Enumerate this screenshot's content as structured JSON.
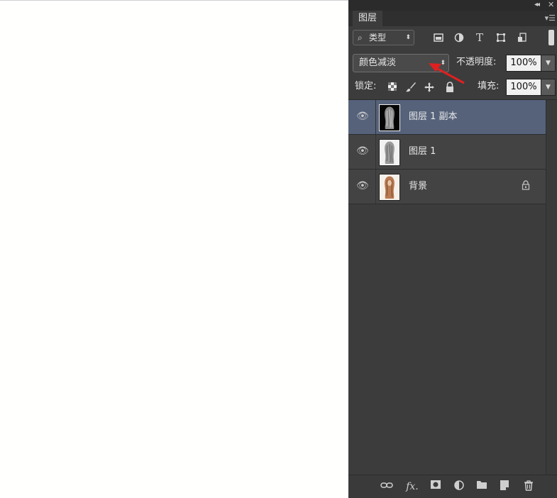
{
  "panel": {
    "tab_label": "图层",
    "filter": {
      "value": "类型"
    },
    "blend_mode": {
      "value": "颜色减淡"
    },
    "opacity": {
      "label": "不透明度:",
      "value": "100%"
    },
    "lock": {
      "label": "锁定:"
    },
    "fill": {
      "label": "填充:",
      "value": "100%"
    }
  },
  "layers": [
    {
      "name": "图层 1 副本",
      "selected": true,
      "locked": false
    },
    {
      "name": "图层 1",
      "selected": false,
      "locked": false
    },
    {
      "name": "背景",
      "selected": false,
      "locked": true
    }
  ],
  "colors": {
    "panel_bg": "#3c3c3c",
    "selected_layer": "#55627a",
    "annotation_arrow": "#e02020"
  },
  "icons": {
    "filter_icons": [
      "image-filter-icon",
      "adjustment-filter-icon",
      "text-filter-icon",
      "shape-filter-icon",
      "smart-object-filter-icon"
    ],
    "lock_icons": [
      "lock-transparent-icon",
      "lock-brush-icon",
      "lock-move-icon",
      "lock-all-icon"
    ],
    "bottom_icons": [
      "link-layers-icon",
      "fx-icon",
      "mask-icon",
      "adjustment-layer-icon",
      "group-folder-icon",
      "new-layer-icon",
      "delete-trash-icon"
    ]
  }
}
